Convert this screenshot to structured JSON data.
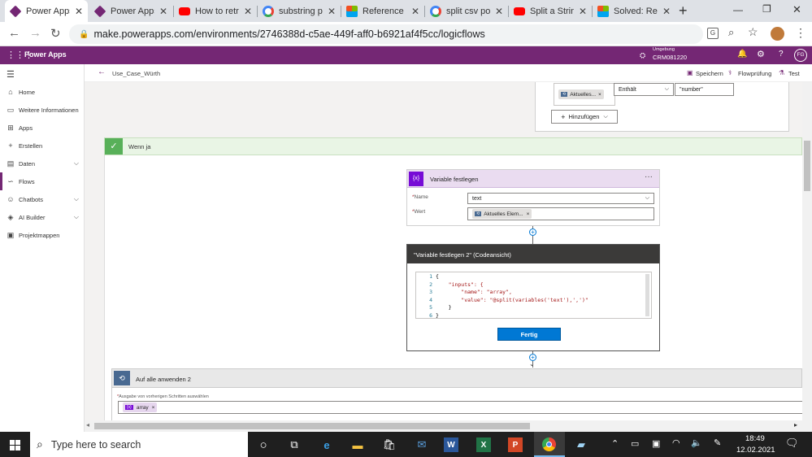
{
  "browser": {
    "tabs": [
      {
        "title": "Power Apps",
        "favicon": "powerapps-icon",
        "color": "#742774",
        "active": true
      },
      {
        "title": "Power Apps",
        "favicon": "powerapps-icon",
        "color": "#742774"
      },
      {
        "title": "How to retri",
        "favicon": "youtube-icon",
        "color": "#ff0000"
      },
      {
        "title": "substring po",
        "favicon": "google-icon",
        "color": "#4285f4"
      },
      {
        "title": "Reference g",
        "favicon": "microsoft-icon",
        "color": "#f25022"
      },
      {
        "title": "split csv pov",
        "favicon": "google-icon",
        "color": "#4285f4"
      },
      {
        "title": "Split a String",
        "favicon": "youtube-icon",
        "color": "#ff0000"
      },
      {
        "title": "Solved: Re: C",
        "favicon": "microsoft-icon",
        "color": "#f25022"
      }
    ],
    "new_tab": "+",
    "url": "make.powerapps.com/environments/2746388d-c5ae-449f-aff0-b6921af4f5cc/logicflows"
  },
  "header": {
    "app_name": "Power Apps",
    "env_label": "Umgebung",
    "env_name": "CRM081220",
    "avatar": "FG"
  },
  "nav": {
    "items": [
      {
        "label": "Home",
        "icon": "home-icon"
      },
      {
        "label": "Weitere Informationen",
        "icon": "book-icon"
      },
      {
        "label": "Apps",
        "icon": "apps-icon"
      },
      {
        "label": "Erstellen",
        "icon": "plus-icon"
      },
      {
        "label": "Daten",
        "icon": "table-icon",
        "chevron": true
      },
      {
        "label": "Flows",
        "icon": "flow-icon",
        "selected": true
      },
      {
        "label": "Chatbots",
        "icon": "chatbot-icon",
        "chevron": true
      },
      {
        "label": "AI Builder",
        "icon": "ai-icon",
        "chevron": true
      },
      {
        "label": "Projektmappen",
        "icon": "solution-icon"
      }
    ]
  },
  "command": {
    "flow_name": "Use_Case_Würth",
    "save": "Speichern",
    "checker": "Flowprüfung",
    "test": "Test"
  },
  "condition": {
    "token": "Aktuelles...",
    "operator": "Enthält",
    "value": "\"number\"",
    "add": "Hinzufügen",
    "yes_branch": "Wenn ja"
  },
  "setvar": {
    "title": "Variable festlegen",
    "name_label": "Name",
    "name_value": "text",
    "value_label": "Wert",
    "value_token": "Aktuelles Elem..."
  },
  "codeview": {
    "title": "\"Variable festlegen 2\" (Codeansicht)",
    "lines": [
      "{",
      "    \"inputs\": {",
      "        \"name\": \"array\",",
      "        \"value\": \"@split(variables('text'),',')\"",
      "    }",
      "}"
    ],
    "line_numbers": [
      "1",
      "2",
      "3",
      "4",
      "5",
      "6"
    ],
    "done": "Fertig"
  },
  "foreach": {
    "title": "Auf alle anwenden 2",
    "field_label": "Ausgabe von vorherigen Schritten auswählen",
    "token": "array"
  },
  "taskbar": {
    "search_placeholder": "Type here to search",
    "time": "18:49",
    "date": "12.02.2021"
  }
}
